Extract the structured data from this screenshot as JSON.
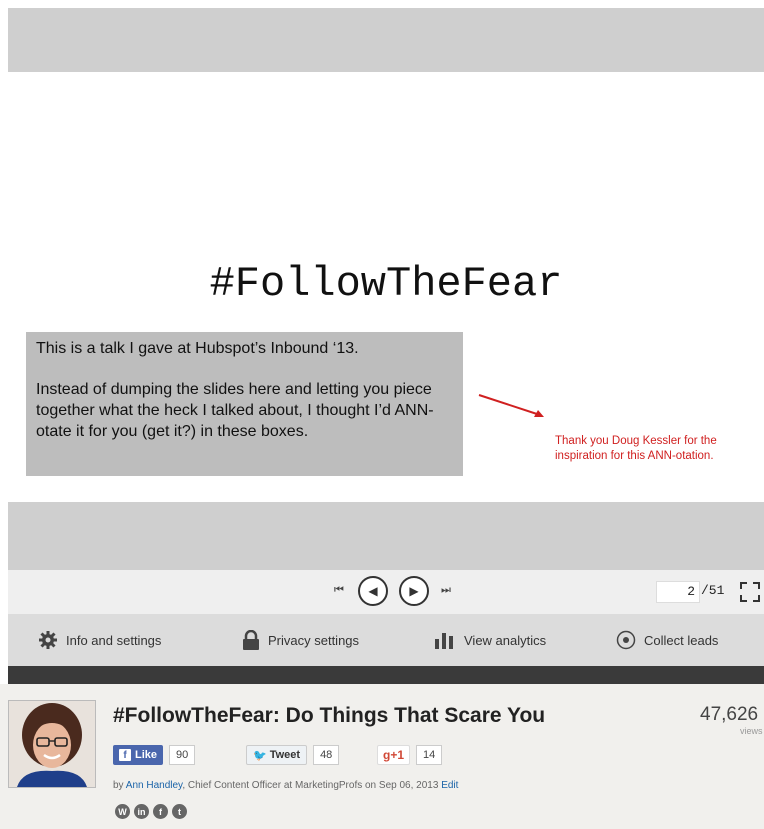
{
  "slide": {
    "title": "#FollowTheFear",
    "annotation_para1": "This is a talk I gave at Hubspot’s Inbound ‘13.",
    "annotation_para2": "Instead of dumping the slides here and letting you piece together what the heck I talked about, I thought I’d ANN-otate it for you (get it?) in these boxes.",
    "thanks_note": "Thank you Doug Kessler for the inspiration for this ANN-otation."
  },
  "player": {
    "current_page": "2",
    "total_pages": "/51"
  },
  "settings_bar": {
    "items": [
      {
        "label": "Info and settings",
        "icon": "gear-icon"
      },
      {
        "label": "Privacy settings",
        "icon": "lock-icon"
      },
      {
        "label": "View analytics",
        "icon": "bar-chart-icon"
      },
      {
        "label": "Collect leads",
        "icon": "leads-icon"
      }
    ]
  },
  "document": {
    "title": "#FollowTheFear: Do Things That Scare You",
    "views_count": "47,626",
    "views_label": "views",
    "facebook": {
      "label": "Like",
      "count": "90"
    },
    "twitter": {
      "label": "Tweet",
      "count": "48"
    },
    "gplus": {
      "label": "+1",
      "count": "14"
    },
    "byline_prefix": "by",
    "author": "Ann Handley",
    "byline_mid": ", Chief Content Officer at MarketingProfs on",
    "date": "Sep 06, 2013",
    "edit_label": "Edit"
  },
  "colors": {
    "accent_red": "#d02020",
    "facebook_blue": "#4a66ad",
    "link_blue": "#1a63a8"
  }
}
